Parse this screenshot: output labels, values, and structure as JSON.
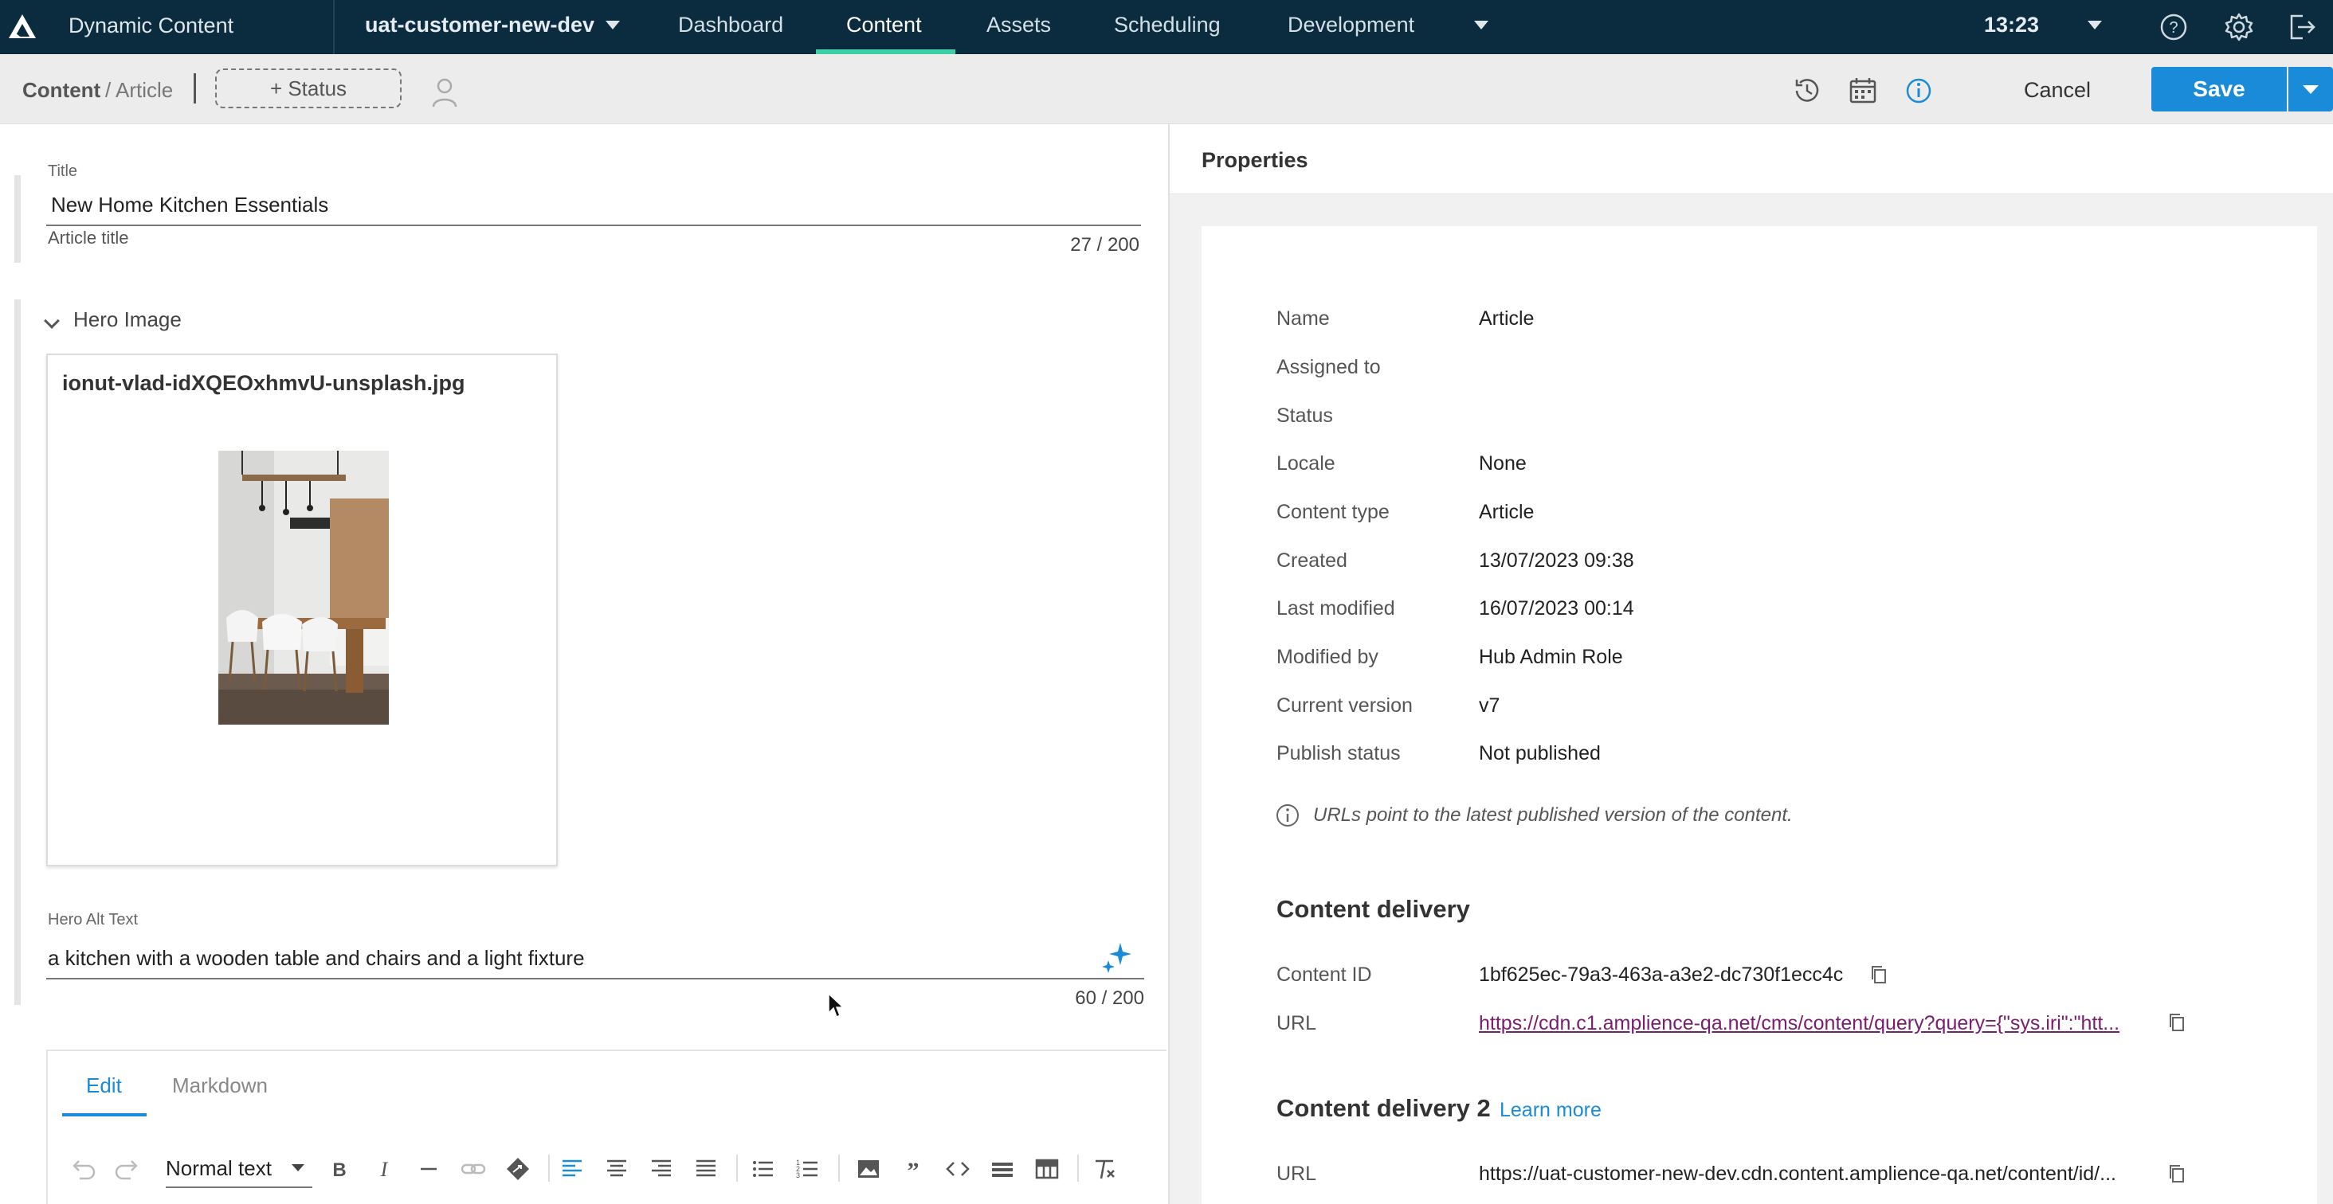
{
  "topbar": {
    "app_name": "Dynamic Content",
    "hub_name": "uat-customer-new-dev",
    "nav": [
      "Dashboard",
      "Content",
      "Assets",
      "Scheduling",
      "Development"
    ],
    "active_nav": "Content",
    "clock": "13:23"
  },
  "toolbar": {
    "breadcrumb_root": "Content",
    "breadcrumb_child": "/ Article",
    "status_label": "+ Status",
    "cancel_label": "Cancel",
    "save_label": "Save"
  },
  "editor": {
    "title_label": "Title",
    "title_value": "New Home Kitchen Essentials",
    "title_help": "Article title",
    "title_count": "27 / 200",
    "hero_label": "Hero Image",
    "hero_filename": "ionut-vlad-idXQEOxhmvU-unsplash.jpg",
    "alt_label": "Hero Alt Text",
    "alt_value": "a kitchen with a wooden table and chairs and a light fixture",
    "alt_count": "60 / 200",
    "rte_tabs": [
      "Edit",
      "Markdown"
    ],
    "rte_style": "Normal text"
  },
  "properties": {
    "title": "Properties",
    "rows": [
      {
        "key": "Name",
        "value": "Article"
      },
      {
        "key": "Assigned to",
        "value": ""
      },
      {
        "key": "Status",
        "value": ""
      },
      {
        "key": "Locale",
        "value": "None"
      },
      {
        "key": "Content type",
        "value": "Article"
      },
      {
        "key": "Created",
        "value": "13/07/2023 09:38"
      },
      {
        "key": "Last modified",
        "value": "16/07/2023 00:14"
      },
      {
        "key": "Modified by",
        "value": "Hub Admin Role"
      },
      {
        "key": "Current version",
        "value": "v7"
      },
      {
        "key": "Publish status",
        "value": "Not published"
      }
    ],
    "note": "URLs point to the latest published version of the content.",
    "delivery": {
      "title": "Content delivery",
      "id_label": "Content ID",
      "id_value": "1bf625ec-79a3-463a-a3e2-dc730f1ecc4c",
      "url_label": "URL",
      "url_value": "https://cdn.c1.amplience-qa.net/cms/content/query?query={\"sys.iri\":\"htt..."
    },
    "delivery2": {
      "title": "Content delivery 2",
      "learn_more": "Learn more",
      "url_label": "URL",
      "url_value": "https://uat-customer-new-dev.cdn.content.amplience-qa.net/content/id/..."
    }
  },
  "colors": {
    "topbar_bg": "#0b2b3f",
    "accent": "#1a8bd8",
    "nav_active_underline": "#3ecfa7",
    "link": "#7b1d6f"
  }
}
